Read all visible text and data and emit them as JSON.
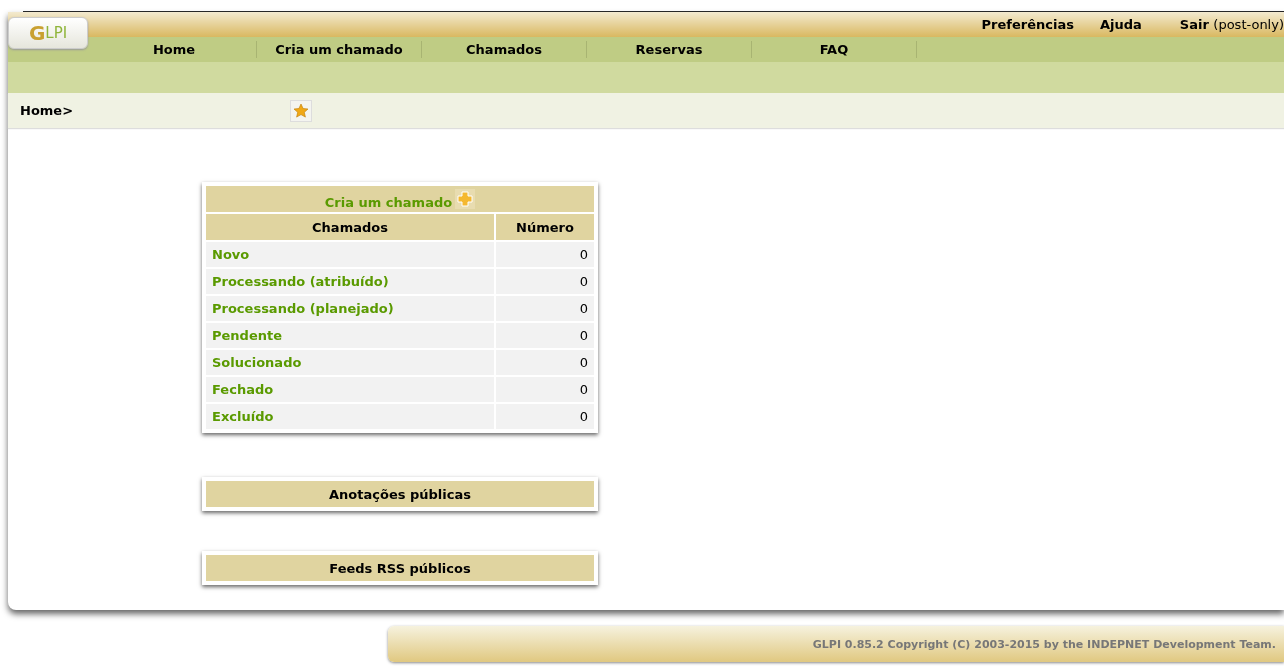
{
  "logo": {
    "text": "GLPI"
  },
  "top_links": [
    {
      "label": "Preferências"
    },
    {
      "label": "Ajuda"
    },
    {
      "label": "Sair",
      "note": "(post-only)"
    }
  ],
  "nav": [
    {
      "label": "Home"
    },
    {
      "label": "Cria um chamado"
    },
    {
      "label": "Chamados"
    },
    {
      "label": "Reservas"
    },
    {
      "label": "FAQ"
    }
  ],
  "breadcrumb": "Home>",
  "tickets_panel": {
    "create_link": "Cria um chamado",
    "columns": [
      "Chamados",
      "Número"
    ],
    "rows": [
      {
        "status": "Novo",
        "count": "0"
      },
      {
        "status": "Processando (atribuído)",
        "count": "0"
      },
      {
        "status": "Processando (planejado)",
        "count": "0"
      },
      {
        "status": "Pendente",
        "count": "0"
      },
      {
        "status": "Solucionado",
        "count": "0"
      },
      {
        "status": "Fechado",
        "count": "0"
      },
      {
        "status": "Excluído",
        "count": "0"
      }
    ]
  },
  "panels": [
    {
      "title": "Anotações públicas"
    },
    {
      "title": "Feeds RSS públicos"
    }
  ],
  "footer": "GLPI 0.85.2 Copyright (C) 2003-2015 by the INDEPNET Development Team."
}
